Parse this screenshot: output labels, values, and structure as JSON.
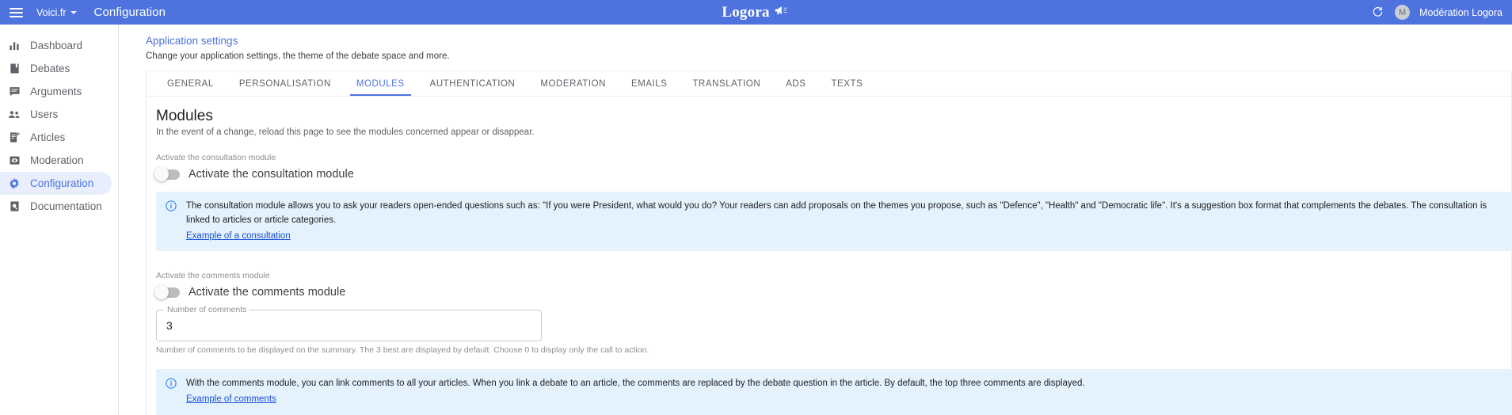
{
  "appbar": {
    "menu_icon": "hamburger-icon",
    "site_name": "Voici.fr",
    "title": "Configuration",
    "brand": "Logora",
    "brand_icon": "megaphone-icon",
    "refresh_icon": "refresh-icon",
    "avatar_initial": "M",
    "user_name": "Modération Logora",
    "accent_color": "#4e73df"
  },
  "sidebar": {
    "items": [
      {
        "label": "Dashboard",
        "icon": "bar-chart-icon",
        "active": false
      },
      {
        "label": "Debates",
        "icon": "book-icon",
        "active": false
      },
      {
        "label": "Arguments",
        "icon": "comment-icon",
        "active": false
      },
      {
        "label": "Users",
        "icon": "people-icon",
        "active": false
      },
      {
        "label": "Articles",
        "icon": "article-add-icon",
        "active": false
      },
      {
        "label": "Moderation",
        "icon": "eye-box-icon",
        "active": false
      },
      {
        "label": "Configuration",
        "icon": "gear-icon",
        "active": true
      },
      {
        "label": "Documentation",
        "icon": "document-search-icon",
        "active": false
      }
    ]
  },
  "page": {
    "link": "Application settings",
    "subtitle": "Change your application settings, the theme of the debate space and more."
  },
  "tabs": [
    {
      "label": "GENERAL",
      "active": false
    },
    {
      "label": "PERSONALISATION",
      "active": false
    },
    {
      "label": "MODULES",
      "active": true
    },
    {
      "label": "AUTHENTICATION",
      "active": false
    },
    {
      "label": "MODERATION",
      "active": false
    },
    {
      "label": "EMAILS",
      "active": false
    },
    {
      "label": "TRANSLATION",
      "active": false
    },
    {
      "label": "ADS",
      "active": false
    },
    {
      "label": "TEXTS",
      "active": false
    }
  ],
  "modules": {
    "heading": "Modules",
    "subheading": "In the event of a change, reload this page to see the modules concerned appear or disappear.",
    "consultation": {
      "caption": "Activate the consultation module",
      "toggle_label": "Activate the consultation module",
      "toggle_state": "off",
      "info_icon": "info-icon",
      "info_text": "The consultation module allows you to ask your readers open-ended questions such as: \"If you were President, what would you do? Your readers can add proposals on the themes you propose, such as \"Defence\", \"Health\" and \"Democratic life\". It's a suggestion box format that complements the debates. The consultation is linked to articles or article categories.",
      "info_link": "Example of a consultation"
    },
    "comments": {
      "caption": "Activate the comments module",
      "toggle_label": "Activate the comments module",
      "toggle_state": "off",
      "field_label": "Number of comments",
      "field_value": "3",
      "field_helper": "Number of comments to be displayed on the summary. The 3 best are displayed by default. Choose 0 to display only the call to action.",
      "info_icon": "info-icon",
      "info_text": "With the comments module, you can link comments to all your articles. When you link a debate to an article, the comments are replaced by the debate question in the article. By default, the top three comments are displayed.",
      "info_link": "Example of comments"
    }
  }
}
